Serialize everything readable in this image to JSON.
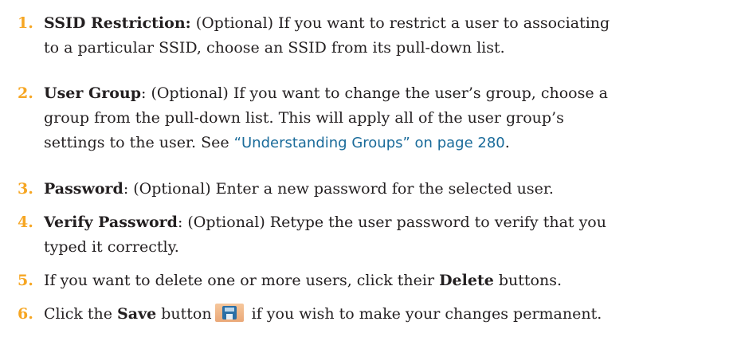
{
  "steps": [
    {
      "number": "1.",
      "label": "SSID Restriction:",
      "line1": " (Optional) If you want to restrict a user to associating",
      "line2": "to a particular SSID, choose an SSID from its pull-down list."
    },
    {
      "number": "2.",
      "label": "User Group",
      "line1": ": (Optional) If you want to change the user’s group, choose a",
      "line2": "group from the pull-down list. This will apply all of the user group’s",
      "line3_pre": "settings to the user. See ",
      "link": "“Understanding Groups” on page 280",
      "line3_post": "."
    },
    {
      "number": "3.",
      "label": "Password",
      "line1": ": (Optional) Enter a new password for the selected user."
    },
    {
      "number": "4.",
      "label": "Verify Password",
      "line1": ": (Optional) Retype the user password to verify that you",
      "line2": "typed it correctly."
    },
    {
      "number": "5.",
      "pre": "If you want to delete one or more users, click their ",
      "label": "Delete",
      "post": " buttons."
    },
    {
      "number": "6.",
      "pre": "Click the ",
      "label": "Save",
      "mid": " button",
      "icon": "save-icon",
      "post": " if you wish to make your changes permanent."
    }
  ]
}
